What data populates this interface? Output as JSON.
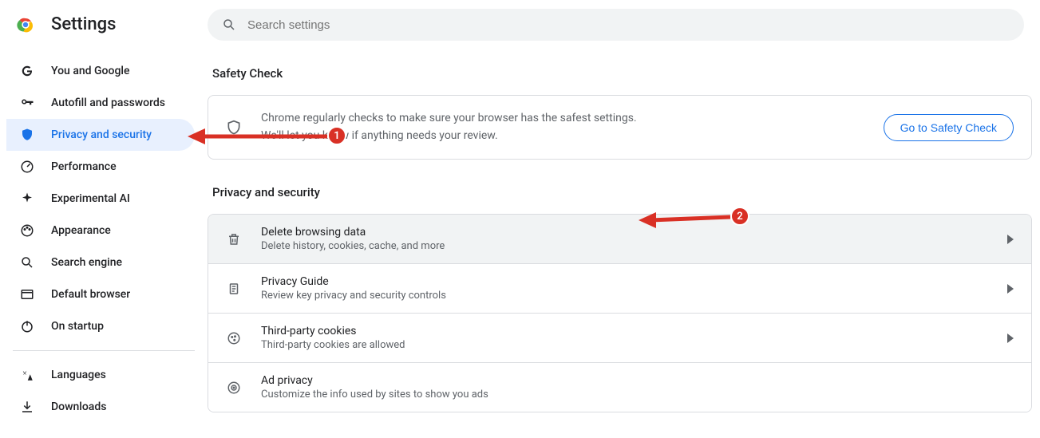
{
  "header": {
    "title": "Settings"
  },
  "search": {
    "placeholder": "Search settings"
  },
  "sidebar": {
    "items": [
      {
        "label": "You and Google"
      },
      {
        "label": "Autofill and passwords"
      },
      {
        "label": "Privacy and security"
      },
      {
        "label": "Performance"
      },
      {
        "label": "Experimental AI"
      },
      {
        "label": "Appearance"
      },
      {
        "label": "Search engine"
      },
      {
        "label": "Default browser"
      },
      {
        "label": "On startup"
      }
    ],
    "secondary": [
      {
        "label": "Languages"
      },
      {
        "label": "Downloads"
      }
    ]
  },
  "safety": {
    "heading": "Safety Check",
    "line1": "Chrome regularly checks to make sure your browser has the safest settings.",
    "line2": "We'll let you know if anything needs your review.",
    "button": "Go to Safety Check"
  },
  "privacy": {
    "heading": "Privacy and security",
    "rows": [
      {
        "title": "Delete browsing data",
        "subtitle": "Delete history, cookies, cache, and more"
      },
      {
        "title": "Privacy Guide",
        "subtitle": "Review key privacy and security controls"
      },
      {
        "title": "Third-party cookies",
        "subtitle": "Third-party cookies are allowed"
      },
      {
        "title": "Ad privacy",
        "subtitle": "Customize the info used by sites to show you ads"
      }
    ]
  },
  "annotations": {
    "step1": "1",
    "step2": "2"
  }
}
